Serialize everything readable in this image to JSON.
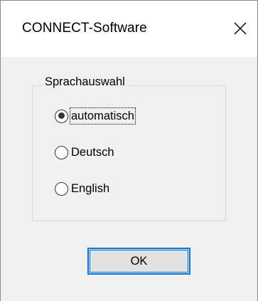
{
  "window": {
    "title": "CONNECT-Software",
    "close_icon": "close-icon"
  },
  "language_group": {
    "legend": "Sprachauswahl",
    "options": [
      {
        "label": "automatisch",
        "checked": true
      },
      {
        "label": "Deutsch",
        "checked": false
      },
      {
        "label": "English",
        "checked": false
      }
    ]
  },
  "buttons": {
    "ok_label": "OK"
  },
  "colors": {
    "focus_accent": "#0078d7",
    "dialog_background": "#f0f0f0",
    "titlebar_background": "#ffffff",
    "button_face": "#e1e1e1"
  }
}
